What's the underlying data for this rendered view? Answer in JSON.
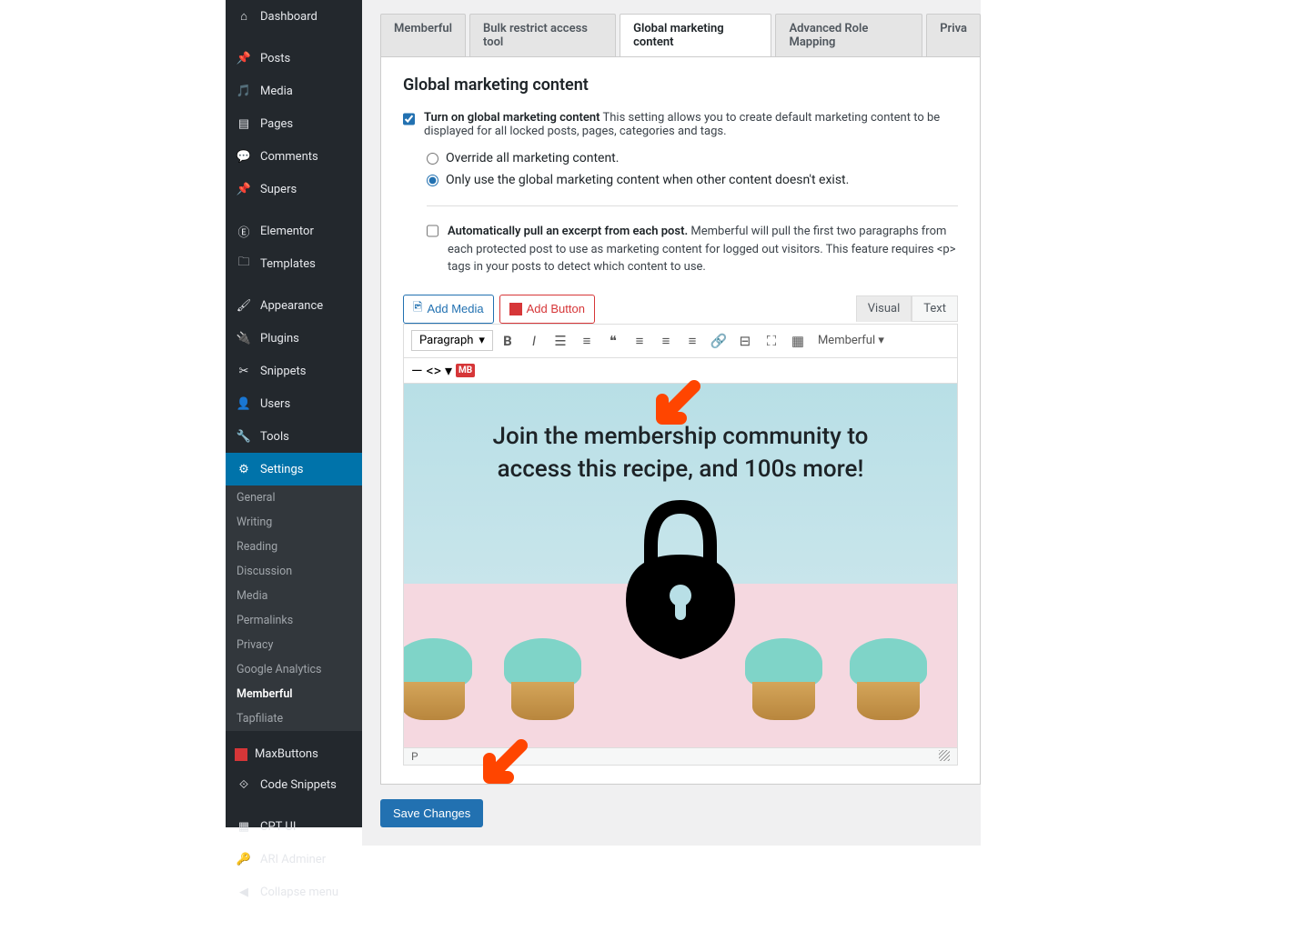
{
  "sidebar": {
    "items": [
      {
        "label": "Dashboard",
        "icon": "dashboard"
      },
      {
        "label": "Posts",
        "icon": "pin"
      },
      {
        "label": "Media",
        "icon": "media"
      },
      {
        "label": "Pages",
        "icon": "pages"
      },
      {
        "label": "Comments",
        "icon": "comment"
      },
      {
        "label": "Supers",
        "icon": "pin"
      },
      {
        "label": "Elementor",
        "icon": "elementor"
      },
      {
        "label": "Templates",
        "icon": "folder"
      },
      {
        "label": "Appearance",
        "icon": "brush"
      },
      {
        "label": "Plugins",
        "icon": "plug"
      },
      {
        "label": "Snippets",
        "icon": "scissors"
      },
      {
        "label": "Users",
        "icon": "user"
      },
      {
        "label": "Tools",
        "icon": "wrench"
      },
      {
        "label": "Settings",
        "icon": "settings",
        "active": true
      },
      {
        "label": "MaxButtons",
        "icon": "square"
      },
      {
        "label": "Code Snippets",
        "icon": "code"
      },
      {
        "label": "CPT UI",
        "icon": "cpt"
      },
      {
        "label": "ARI Adminer",
        "icon": "key"
      },
      {
        "label": "Collapse menu",
        "icon": "collapse"
      }
    ],
    "sub": [
      {
        "label": "General"
      },
      {
        "label": "Writing"
      },
      {
        "label": "Reading"
      },
      {
        "label": "Discussion"
      },
      {
        "label": "Media"
      },
      {
        "label": "Permalinks"
      },
      {
        "label": "Privacy"
      },
      {
        "label": "Google Analytics"
      },
      {
        "label": "Memberful",
        "active": true
      },
      {
        "label": "Tapfiliate"
      }
    ]
  },
  "tabs": [
    {
      "label": "Memberful"
    },
    {
      "label": "Bulk restrict access tool"
    },
    {
      "label": "Global marketing content",
      "active": true
    },
    {
      "label": "Advanced Role Mapping"
    },
    {
      "label": "Priva"
    }
  ],
  "section": {
    "title": "Global marketing content",
    "enable_label": "Turn on global marketing content",
    "enable_desc": "This setting allows you to create default marketing content to be displayed for all locked posts, pages, categories and tags.",
    "radio1": "Override all marketing content.",
    "radio2": "Only use the global marketing content when other content doesn't exist.",
    "radio_selected": 2,
    "excerpt_label": "Automatically pull an excerpt from each post.",
    "excerpt_desc": "Memberful will pull the first two paragraphs from each protected post to use as marketing content for logged out visitors. This feature requires <p> tags in your posts to detect which content to use."
  },
  "editor": {
    "add_media": "Add Media",
    "add_button": "Add Button",
    "tab_visual": "Visual",
    "tab_text": "Text",
    "format_sel": "Paragraph",
    "memberful_menu": "Memberful",
    "content_line1": "Join the membership community to",
    "content_line2": "access this recipe, and 100s more!",
    "status": "P"
  },
  "save_button": "Save Changes"
}
